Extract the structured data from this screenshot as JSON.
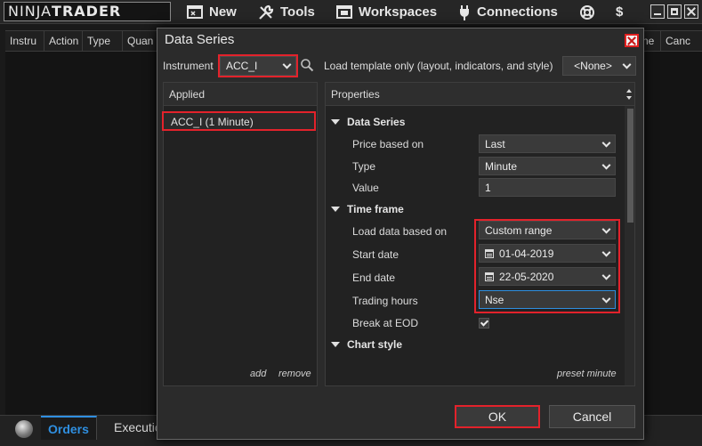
{
  "menubar": {
    "logo_light": "NINJA",
    "logo_bold": "TRADER",
    "items": [
      {
        "label": "New",
        "icon": "new-window-icon"
      },
      {
        "label": "Tools",
        "icon": "wrench-icon"
      },
      {
        "label": "Workspaces",
        "icon": "workspaces-icon"
      },
      {
        "label": "Connections",
        "icon": "plug-icon"
      },
      {
        "label": "",
        "icon": "lifebuoy-icon"
      },
      {
        "label": "",
        "icon": "dollar-icon"
      }
    ],
    "dollar": "$"
  },
  "orders_grid": {
    "columns": [
      "Instru",
      "Action",
      "Type",
      "Quan",
      "ne",
      "Canc"
    ]
  },
  "bottom_tabs": [
    "Orders",
    "Executio"
  ],
  "dialog": {
    "title": "Data Series",
    "instrument_label": "Instrument",
    "instrument_value": "ACC_I",
    "template_label": "Load template only (layout, indicators, and style)",
    "template_value": "<None>",
    "applied_header": "Applied",
    "applied_items": [
      "ACC_I (1 Minute)"
    ],
    "add_link": "add",
    "remove_link": "remove",
    "properties_header": "Properties",
    "sections": {
      "data_series": "Data Series",
      "time_frame": "Time frame",
      "chart_style": "Chart style"
    },
    "properties": {
      "price_based_on": {
        "label": "Price based on",
        "value": "Last"
      },
      "type": {
        "label": "Type",
        "value": "Minute"
      },
      "value": {
        "label": "Value",
        "value": "1"
      },
      "load_data": {
        "label": "Load data based on",
        "value": "Custom range"
      },
      "start_date": {
        "label": "Start date",
        "value": "01-04-2019"
      },
      "end_date": {
        "label": "End date",
        "value": "22-05-2020"
      },
      "trading_hours": {
        "label": "Trading hours",
        "value": "Nse"
      },
      "break_eod": {
        "label": "Break at EOD",
        "checked": true
      }
    },
    "preset_link": "preset minute",
    "ok_label": "OK",
    "cancel_label": "Cancel"
  },
  "colors": {
    "highlight_red": "#e3222b",
    "accent_blue": "#2f8fe0"
  }
}
